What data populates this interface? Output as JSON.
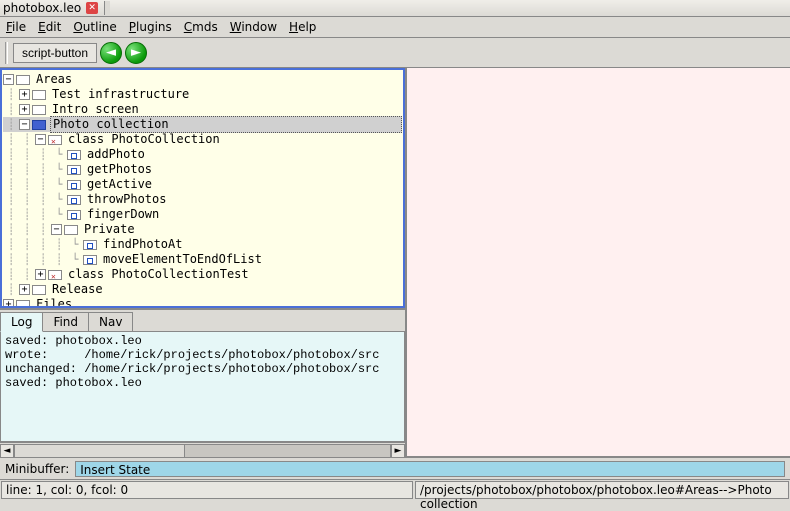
{
  "window": {
    "title": "photobox.leo"
  },
  "menu": {
    "file": "File",
    "edit": "Edit",
    "outline": "Outline",
    "plugins": "Plugins",
    "cmds": "Cmds",
    "window": "Window",
    "help": "Help"
  },
  "toolbar": {
    "script_button": "script-button"
  },
  "tree": {
    "areas": "Areas",
    "test_infra": "Test infrastructure",
    "intro": "Intro screen",
    "photo_coll": "Photo collection",
    "class_pc": "class PhotoCollection",
    "addPhoto": "addPhoto",
    "getPhotos": "getPhotos",
    "getActive": "getActive",
    "throwPhotos": "throwPhotos",
    "fingerDown": "fingerDown",
    "private": "Private",
    "findPhotoAt": "findPhotoAt",
    "moveEl": "moveElementToEndOfList",
    "class_pct": "class PhotoCollectionTest",
    "release": "Release",
    "files": "Files"
  },
  "log": {
    "tabs": {
      "log": "Log",
      "find": "Find",
      "nav": "Nav"
    },
    "lines": [
      "saved: photobox.leo",
      "wrote:     /home/rick/projects/photobox/photobox/src",
      "unchanged: /home/rick/projects/photobox/photobox/src",
      "saved: photobox.leo"
    ]
  },
  "minibuffer": {
    "label": "Minibuffer:",
    "value": "Insert State"
  },
  "status": {
    "left": "line: 1, col: 0, fcol: 0",
    "right": "/projects/photobox/photobox/photobox.leo#Areas-->Photo collection"
  }
}
